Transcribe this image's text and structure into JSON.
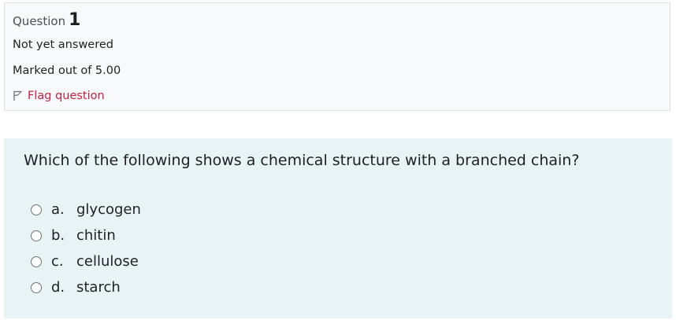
{
  "info": {
    "question_label": "Question",
    "question_number": "1",
    "state": "Not yet answered",
    "grade": "Marked out of 5.00",
    "flag_label": "Flag question"
  },
  "question": {
    "text": "Which of the following shows a chemical structure with a branched chain?",
    "answers": [
      {
        "letter": "a.",
        "text": "glycogen"
      },
      {
        "letter": "b.",
        "text": "chitin"
      },
      {
        "letter": "c.",
        "text": "cellulose"
      },
      {
        "letter": "d.",
        "text": "starch"
      }
    ]
  },
  "colors": {
    "flag": "#c0203e",
    "question_background": "#e7f3f5",
    "info_background": "#f8f9fa"
  },
  "icons": {
    "flag": "flag-outline-icon",
    "radio": "radio-unchecked-icon"
  }
}
